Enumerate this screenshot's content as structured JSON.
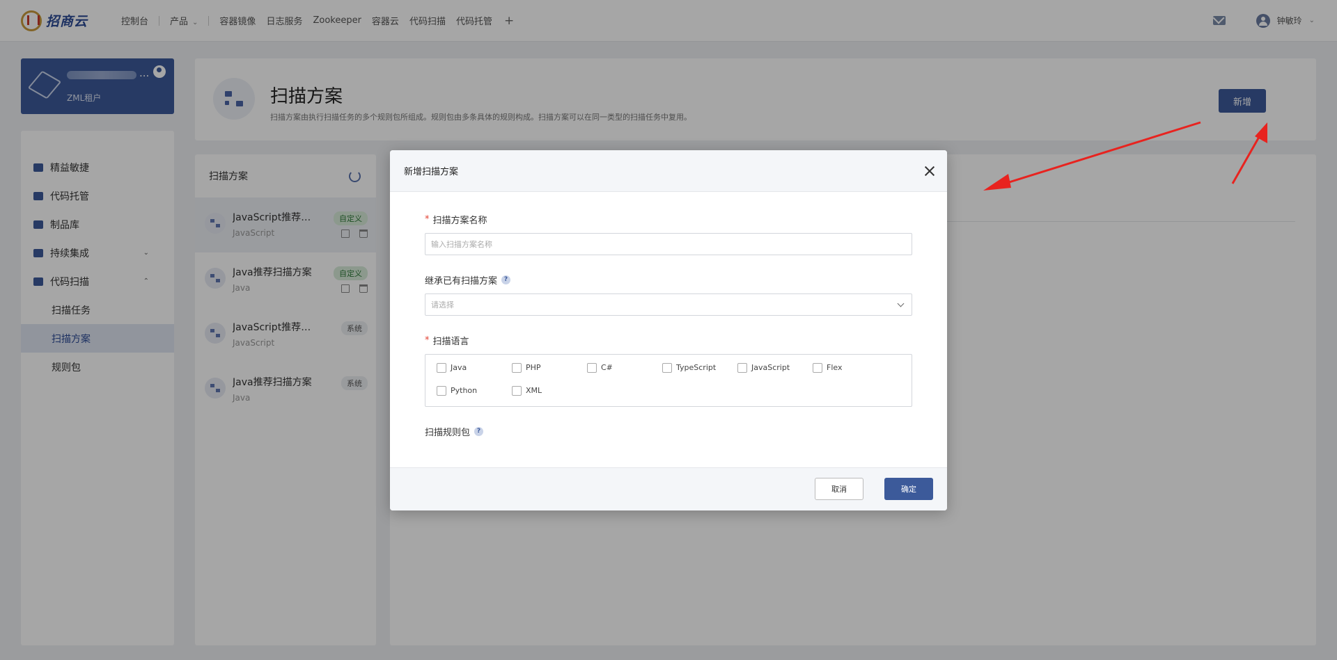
{
  "brand": {
    "logo_text": "招商云"
  },
  "nav": {
    "console": "控制台",
    "products": "产品",
    "items": [
      "容器镜像",
      "日志服务",
      "Zookeeper",
      "容器云",
      "代码扫描",
      "代码托管"
    ],
    "plus": "+"
  },
  "user": {
    "name": "钟敏玲"
  },
  "tenant": {
    "dots": "...",
    "name": "ZML租户"
  },
  "sidebar": {
    "items": [
      {
        "label": "精益敏捷"
      },
      {
        "label": "代码托管"
      },
      {
        "label": "制品库"
      },
      {
        "label": "持续集成"
      },
      {
        "label": "代码扫描"
      },
      {
        "label": "扫描任务"
      },
      {
        "label": "扫描方案"
      },
      {
        "label": "规则包"
      }
    ]
  },
  "header": {
    "title": "扫描方案",
    "description": "扫描方案由执行扫描任务的多个规则包所组成。规则包由多条具体的规则构成。扫描方案可以在同一类型的扫描任务中复用。",
    "add_label": "新增"
  },
  "plan_list": {
    "title": "扫描方案",
    "items": [
      {
        "name": "JavaScript推荐扫描方案",
        "lang": "JavaScript",
        "tag": "自定义"
      },
      {
        "name": "Java推荐扫描方案",
        "lang": "Java",
        "tag": "自定义"
      },
      {
        "name": "JavaScript推荐扫描方案",
        "lang": "JavaScript",
        "tag": "系统"
      },
      {
        "name": "Java推荐扫描方案",
        "lang": "Java",
        "tag": "系统"
      }
    ]
  },
  "modal": {
    "title": "新增扫描方案",
    "required_mark": "*",
    "help": "?",
    "name_label": "扫描方案名称",
    "name_placeholder": "输入扫描方案名称",
    "name_value": "",
    "inherit_label": "继承已有扫描方案",
    "inherit_placeholder": "请选择",
    "lang_label": "扫描语言",
    "languages": [
      "Java",
      "PHP",
      "C#",
      "TypeScript",
      "JavaScript",
      "Flex",
      "Python",
      "XML"
    ],
    "rules_label": "扫描规则包",
    "cancel_label": "取消",
    "ok_label": "确定"
  },
  "colors": {
    "primary": "#3c5a9a",
    "annotation_arrow": "#e8231f",
    "required": "#e34234"
  }
}
